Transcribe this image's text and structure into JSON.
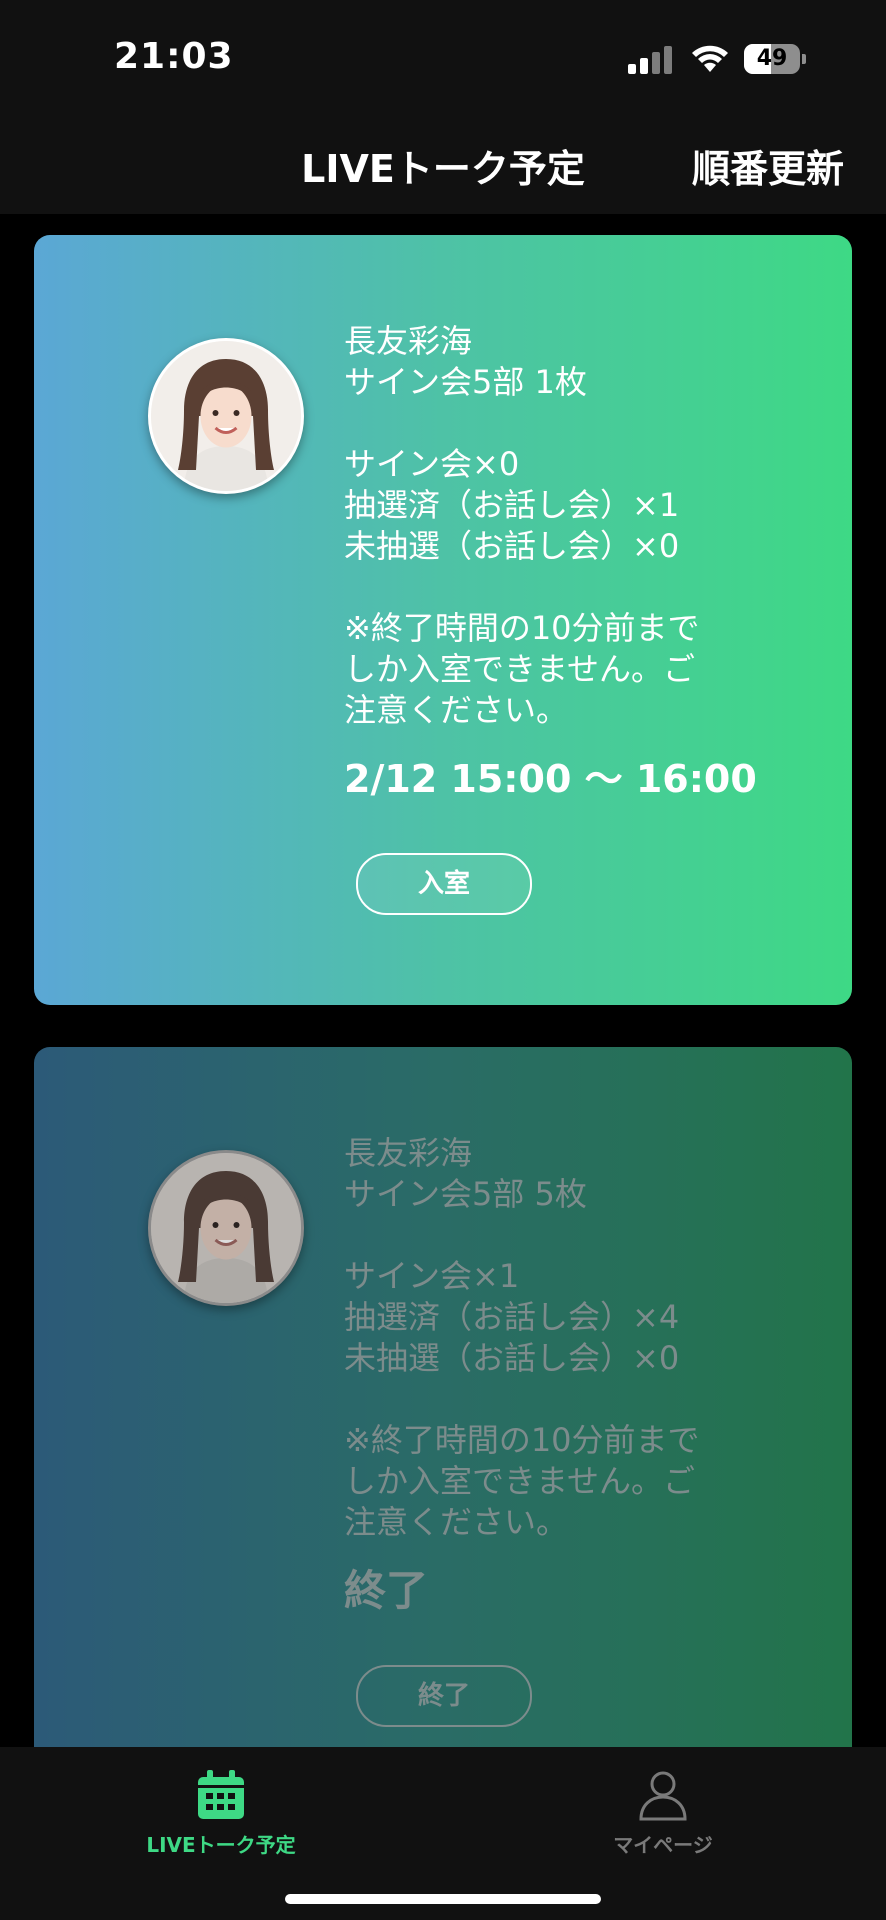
{
  "status_bar": {
    "time": "21:03",
    "battery": "49",
    "battery_level": 0.49
  },
  "header": {
    "title": "LIVEトーク予定",
    "reorder_label": "順番更新"
  },
  "cards": [
    {
      "name": "長友彩海",
      "event": "サイン会5部 1枚",
      "sign_count": "サイン会×0",
      "drawn": "抽選済（お話し会）×1",
      "undrawn": "未抽選（お話し会）×0",
      "note_line1": "※終了時間の10分前まで",
      "note_line2": "しか入室できません。ご",
      "note_line3": "注意ください。",
      "date": "2/12 15:00 〜 16:00",
      "button": "入室"
    },
    {
      "name": "長友彩海",
      "event": "サイン会5部 5枚",
      "sign_count": "サイン会×1",
      "drawn": "抽選済（お話し会）×4",
      "undrawn": "未抽選（お話し会）×0",
      "note_line1": "※終了時間の10分前まで",
      "note_line2": "しか入室できません。ご",
      "note_line3": "注意ください。",
      "date": "終了",
      "button": "終了"
    }
  ],
  "tabbar": {
    "tabs": [
      {
        "label": "LIVEトーク予定",
        "icon": "calendar-icon",
        "active": true,
        "color": "#3ed985"
      },
      {
        "label": "マイページ",
        "icon": "person-icon",
        "active": false,
        "color": "#7a7a7a"
      }
    ]
  }
}
